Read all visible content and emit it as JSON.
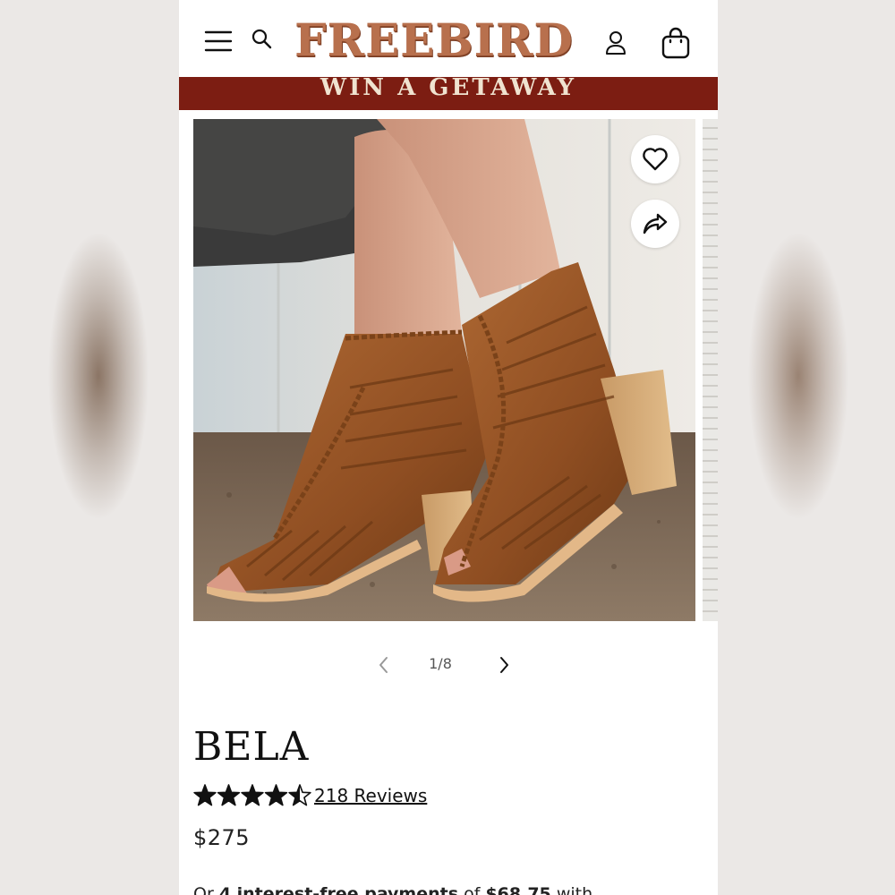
{
  "header": {
    "brand": "FREEBIRD",
    "icons": [
      "menu-icon",
      "search-icon",
      "account-icon",
      "shopping-bag-icon"
    ]
  },
  "promo": {
    "text": "WIN A GETAWAY"
  },
  "gallery": {
    "current": 1,
    "total": 8,
    "counter": "1/8",
    "actions": [
      "heart-icon",
      "share-icon"
    ]
  },
  "product": {
    "name": "BELA",
    "rating": 4.5,
    "rating_max": 5,
    "reviews_label": "218 Reviews",
    "price": "$275",
    "installments_prefix": "Or ",
    "installments_bold": "4 interest-free payments",
    "installments_mid": " of ",
    "installments_amount": "$68.75",
    "installments_suffix": " with"
  },
  "colors": {
    "brand": "#b8704d",
    "promo_bg": "#7c1d12",
    "promo_text": "#f0e3d0",
    "text": "#111111"
  }
}
